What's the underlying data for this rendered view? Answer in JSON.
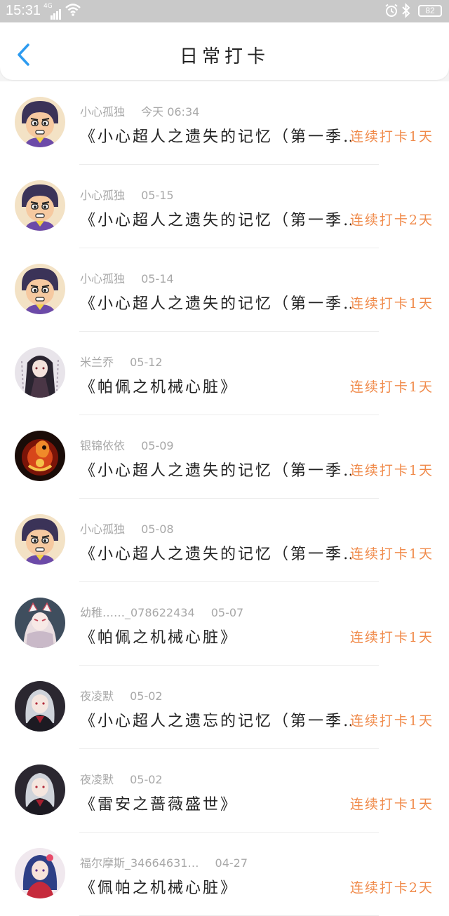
{
  "status_bar": {
    "time": "15:31",
    "network": "4G",
    "battery": "82"
  },
  "header": {
    "title": "日常打卡"
  },
  "colors": {
    "accent_blue": "#2d9bf0",
    "streak_orange": "#f08a4a"
  },
  "records": [
    {
      "user": "小心孤独",
      "date": "今天 06:34",
      "book": "《小心超人之遗失的记忆（第一季…",
      "streak": "连续打卡1天",
      "avatar": "cartoon-boy"
    },
    {
      "user": "小心孤独",
      "date": "05-15",
      "book": "《小心超人之遗失的记忆（第一季…",
      "streak": "连续打卡2天",
      "avatar": "cartoon-boy"
    },
    {
      "user": "小心孤独",
      "date": "05-14",
      "book": "《小心超人之遗失的记忆（第一季…",
      "streak": "连续打卡1天",
      "avatar": "cartoon-boy"
    },
    {
      "user": "米兰乔",
      "date": "05-12",
      "book": "《帕佩之机械心脏》",
      "streak": "连续打卡1天",
      "avatar": "anime-girl-dark"
    },
    {
      "user": "银锦依依",
      "date": "05-09",
      "book": "《小心超人之遗失的记忆（第一季…",
      "streak": "连续打卡1天",
      "avatar": "fire-creature"
    },
    {
      "user": "小心孤独",
      "date": "05-08",
      "book": "《小心超人之遗失的记忆（第一季…",
      "streak": "连续打卡1天",
      "avatar": "cartoon-boy"
    },
    {
      "user": "幼稚……_078622434",
      "date": "05-07",
      "book": "《帕佩之机械心脏》",
      "streak": "连续打卡1天",
      "avatar": "fox-mask-girl"
    },
    {
      "user": "夜凌默",
      "date": "05-02",
      "book": "《小心超人之遗忘的记忆（第一季…",
      "streak": "连续打卡1天",
      "avatar": "silver-hair-girl"
    },
    {
      "user": "夜凌默",
      "date": "05-02",
      "book": "《雷安之蔷薇盛世》",
      "streak": "连续打卡1天",
      "avatar": "silver-hair-girl"
    },
    {
      "user": "福尔摩斯_34664631…",
      "date": "04-27",
      "book": "《佩帕之机械心脏》",
      "streak": "连续打卡2天",
      "avatar": "blue-anime-girl"
    }
  ]
}
